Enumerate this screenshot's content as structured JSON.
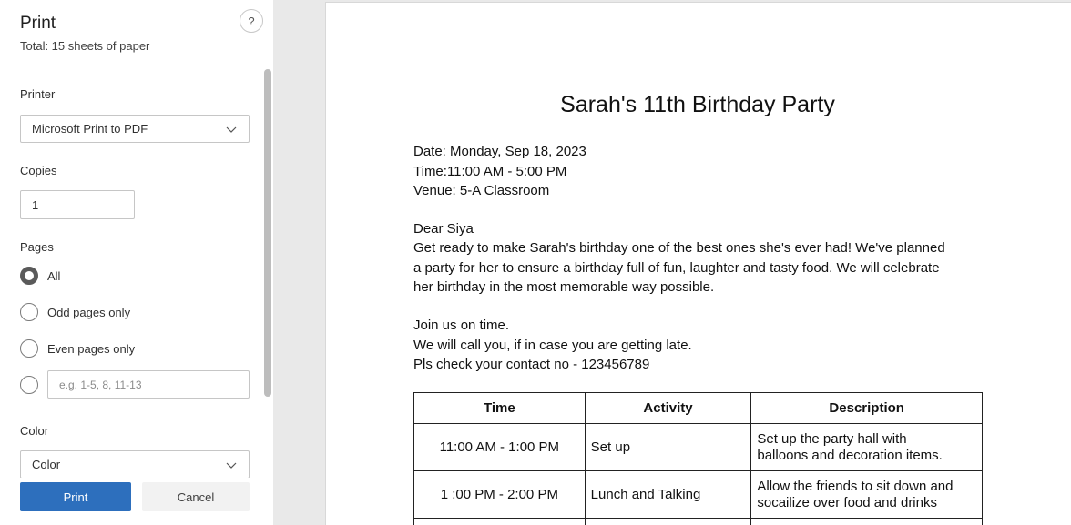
{
  "panel": {
    "title": "Print",
    "subtitle": "Total: 15 sheets of paper",
    "help_label": "?",
    "printer_label": "Printer",
    "printer_value": "Microsoft Print to PDF",
    "copies_label": "Copies",
    "copies_value": "1",
    "pages_label": "Pages",
    "page_options": [
      "All",
      "Odd pages only",
      "Even pages only"
    ],
    "selected_page_option": "All",
    "range_placeholder": "e.g. 1-5, 8, 11-13",
    "color_label": "Color",
    "color_value": "Color",
    "print_button": "Print",
    "cancel_button": "Cancel"
  },
  "document": {
    "title": "Sarah's 11th Birthday Party",
    "date": "Date: Monday, Sep 18, 2023",
    "time": "Time:11:00 AM - 5:00 PM",
    "venue": "Venue: 5-A Classroom",
    "greeting": "Dear Siya",
    "body_lines": [
      "Get ready to make Sarah's birthday one of the best ones she's ever had! We've planned",
      "a party for her to ensure a birthday full of fun, laughter and tasty food. We will celebrate",
      "her birthday in the most memorable way possible."
    ],
    "closing_lines": [
      "Join us on time.",
      "We will call you, if in case you are getting late.",
      "Pls check your contact no - 123456789"
    ],
    "table": {
      "headers": [
        "Time",
        "Activity",
        "Description"
      ],
      "rows": [
        {
          "time": "11:00 AM - 1:00 PM",
          "activity": "Set up",
          "description_lines": [
            "Set up the party hall with",
            "balloons and decoration items."
          ]
        },
        {
          "time": "1 :00 PM - 2:00 PM",
          "activity": "Lunch and Talking",
          "description_lines": [
            "Allow the friends to sit down and",
            "socailize over food and drinks"
          ]
        }
      ]
    }
  },
  "colors": {
    "accent": "#2d6fbd",
    "panel_bg": "#ffffff",
    "preview_bg": "#e9e9e9"
  }
}
